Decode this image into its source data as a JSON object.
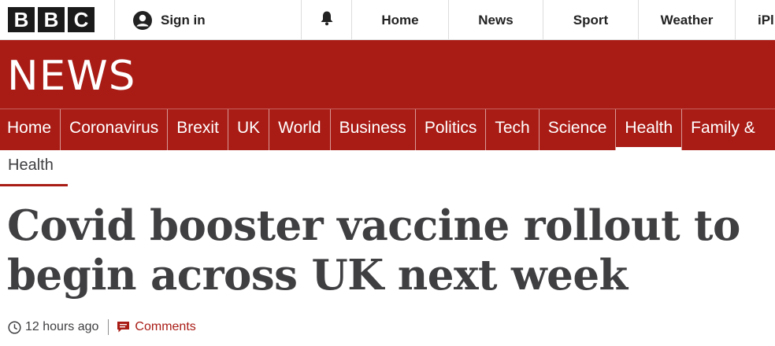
{
  "brand": {
    "letters": [
      "B",
      "B",
      "C"
    ],
    "news_wordmark": "NEWS"
  },
  "top_nav": {
    "sign_in": "Sign in",
    "items": [
      "Home",
      "News",
      "Sport",
      "Weather",
      "iPl"
    ]
  },
  "section_nav": {
    "items": [
      "Home",
      "Coronavirus",
      "Brexit",
      "UK",
      "World",
      "Business",
      "Politics",
      "Tech",
      "Science",
      "Health",
      "Family &"
    ],
    "active": "Health"
  },
  "article": {
    "section": "Health",
    "headline": "Covid booster vaccine rollout to begin across UK next week",
    "timestamp": "12 hours ago",
    "comments_label": "Comments"
  },
  "colors": {
    "news_red": "#a91c16",
    "text_dark": "#3f3f42"
  }
}
